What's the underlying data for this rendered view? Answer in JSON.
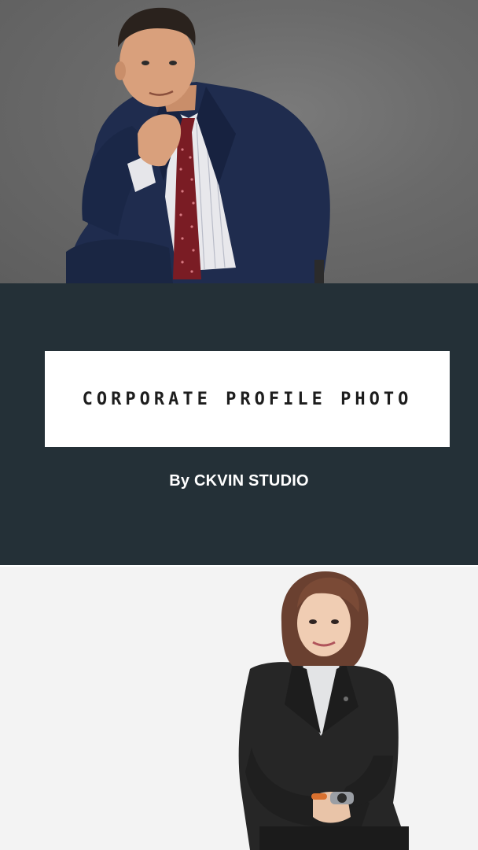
{
  "banner": {
    "title": "CORPORATE PROFILE PHOTO",
    "byline": "By CKVIN STUDIO"
  },
  "photos": {
    "top": {
      "subject": "man in navy suit with red dotted tie, hand on chin, grey backdrop"
    },
    "bottom": {
      "subject": "woman in black blazer with white blouse, seated, white backdrop"
    }
  },
  "colors": {
    "banner_bg": "#243037",
    "title_box_bg": "#ffffff",
    "title_text": "#1d1d1d",
    "byline_text": "#ffffff",
    "top_backdrop": "#6a6a6a",
    "bottom_backdrop": "#f3f3f3",
    "suit_navy": "#1f2c4e",
    "tie_red": "#7a1c24",
    "blazer_black": "#262626"
  }
}
